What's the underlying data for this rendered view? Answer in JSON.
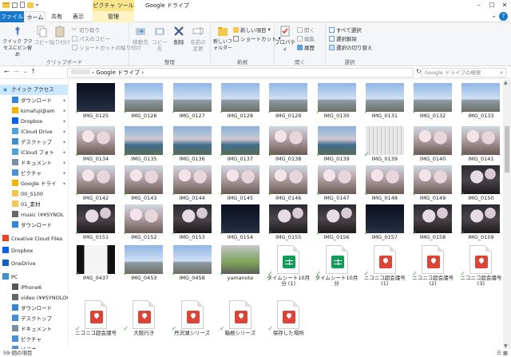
{
  "titlebar": {
    "context_tab": "ピクチャ ツール",
    "title": "Google ドライブ",
    "colors": {
      "accent": "#1979ca",
      "context": "#f8e58c"
    }
  },
  "tabs": {
    "file": "ファイル",
    "home": "ホーム",
    "share": "共有",
    "view": "表示",
    "manage": "管理"
  },
  "ribbon": {
    "clipboard": {
      "label": "クリップボード",
      "pin": "クイック アクセスにピン留め",
      "copy": "コピー",
      "paste": "貼り付け",
      "cut": "切り取り",
      "copy_path": "パスのコピー",
      "paste_shortcut": "ショートカットの貼り付け"
    },
    "organize": {
      "label": "整理",
      "move_to": "移動先",
      "copy_to": "コピー先",
      "delete": "削除",
      "rename": "名前の変更"
    },
    "new": {
      "label": "新規",
      "new_folder": "新しいフォルダー",
      "new_item": "新しい項目",
      "shortcut": "ショートカット"
    },
    "open": {
      "label": "開く",
      "properties": "プロパティ",
      "open": "開く",
      "edit": "編集",
      "history": "履歴"
    },
    "select": {
      "label": "選択",
      "select_all": "すべて選択",
      "select_none": "選択解除",
      "invert": "選択の切り替え"
    }
  },
  "address": {
    "path_root": "Google ドライブ",
    "search_placeholder": "Google ドライブの検索"
  },
  "nav": {
    "items": [
      {
        "label": "クイック アクセス",
        "icon": "star-icon",
        "color": "#2e86de"
      },
      {
        "label": "ダウンロード",
        "icon": "download-icon",
        "color": "#2e86de"
      },
      {
        "label": "kimafuji@am",
        "icon": "google-drive-icon",
        "color": "#f4b400"
      },
      {
        "label": "Dropbox",
        "icon": "dropbox-icon",
        "color": "#0061ff"
      },
      {
        "label": "iCloud Drive",
        "icon": "icloud-icon",
        "color": "#4aa3df"
      },
      {
        "label": "デスクトップ",
        "icon": "desktop-icon",
        "color": "#3d8fd8"
      },
      {
        "label": "iCloud フォト",
        "icon": "icloud-photo-icon",
        "color": "#4aa3df"
      },
      {
        "label": "ドキュメント",
        "icon": "document-icon",
        "color": "#7b8ea3"
      },
      {
        "label": "ピクチャ",
        "icon": "pictures-icon",
        "color": "#4a90d9"
      },
      {
        "label": "Google ドライ",
        "icon": "google-drive-icon",
        "color": "#f4b400"
      },
      {
        "label": "00_S100",
        "icon": "folder-icon",
        "color": "#f2c94c"
      },
      {
        "label": "01_素材",
        "icon": "folder-icon",
        "color": "#f2c94c"
      },
      {
        "label": "music (¥¥SYNOL",
        "icon": "network-drive-icon",
        "color": "#666666"
      },
      {
        "label": "ダウンロード",
        "icon": "download-icon",
        "color": "#2e86de"
      },
      {
        "label": "Creative Cloud Files",
        "icon": "creative-cloud-icon",
        "color": "#e8462b"
      },
      {
        "label": "Dropbox",
        "icon": "dropbox-icon",
        "color": "#0061ff"
      },
      {
        "label": "OneDrive",
        "icon": "onedrive-icon",
        "color": "#0a64c8"
      },
      {
        "label": "PC",
        "icon": "pc-icon",
        "color": "#3d8fd8"
      },
      {
        "label": "iPhone6",
        "icon": "phone-icon",
        "color": "#555555"
      },
      {
        "label": "video (¥¥SYNOLOG",
        "icon": "network-drive-icon",
        "color": "#666666"
      },
      {
        "label": "ダウンロード",
        "icon": "download-icon",
        "color": "#2e86de"
      },
      {
        "label": "デスクトップ",
        "icon": "desktop-icon",
        "color": "#3d8fd8"
      },
      {
        "label": "ドキュメント",
        "icon": "document-icon",
        "color": "#7b8ea3"
      },
      {
        "label": "ピクチャ",
        "icon": "pictures-icon",
        "color": "#4a90d9"
      },
      {
        "label": "ビデオ",
        "icon": "video-icon",
        "color": "#4a90d9"
      }
    ]
  },
  "files": [
    {
      "name": "IMG_0125",
      "kind": "photo",
      "style": "night"
    },
    {
      "name": "IMG_0126",
      "kind": "photo",
      "style": "sky"
    },
    {
      "name": "IMG_0127",
      "kind": "photo",
      "style": "sky"
    },
    {
      "name": "IMG_0128",
      "kind": "photo",
      "style": "sky"
    },
    {
      "name": "IMG_0129",
      "kind": "photo",
      "style": "sky"
    },
    {
      "name": "IMG_0130",
      "kind": "photo",
      "style": "sky"
    },
    {
      "name": "IMG_0131",
      "kind": "photo",
      "style": "sky"
    },
    {
      "name": "IMG_0132",
      "kind": "photo",
      "style": "sky"
    },
    {
      "name": "IMG_0133",
      "kind": "photo",
      "style": "sky"
    },
    {
      "name": "IMG_0134",
      "kind": "photo",
      "style": "blossom"
    },
    {
      "name": "IMG_0135",
      "kind": "photo",
      "style": "river"
    },
    {
      "name": "IMG_0136",
      "kind": "photo",
      "style": "river"
    },
    {
      "name": "IMG_0137",
      "kind": "photo",
      "style": "river"
    },
    {
      "name": "IMG_0138",
      "kind": "photo",
      "style": "blossom"
    },
    {
      "name": "IMG_0139",
      "kind": "photo",
      "style": "river"
    },
    {
      "name": "IMG_0139",
      "kind": "photo",
      "style": "keyboard"
    },
    {
      "name": "IMG_0140",
      "kind": "photo",
      "style": "blossom"
    },
    {
      "name": "IMG_0141",
      "kind": "photo",
      "style": "blossom"
    },
    {
      "name": "IMG_0142",
      "kind": "photo",
      "style": "blossom"
    },
    {
      "name": "IMG_0143",
      "kind": "photo",
      "style": "blossom"
    },
    {
      "name": "IMG_0144",
      "kind": "photo",
      "style": "blossom"
    },
    {
      "name": "IMG_0145",
      "kind": "photo",
      "style": "blossom"
    },
    {
      "name": "IMG_0146",
      "kind": "photo",
      "style": "blossom"
    },
    {
      "name": "IMG_0147",
      "kind": "photo",
      "style": "blossom"
    },
    {
      "name": "IMG_0148",
      "kind": "photo",
      "style": "blossom"
    },
    {
      "name": "IMG_0149",
      "kind": "photo",
      "style": "blossom"
    },
    {
      "name": "IMG_0150",
      "kind": "photo",
      "style": "blossomdark"
    },
    {
      "name": "IMG_0151",
      "kind": "photo",
      "style": "blossomdark"
    },
    {
      "name": "IMG_0152",
      "kind": "photo",
      "style": "blossom"
    },
    {
      "name": "IMG_0153",
      "kind": "photo",
      "style": "blossomdark"
    },
    {
      "name": "IMG_0154",
      "kind": "photo",
      "style": "night"
    },
    {
      "name": "IMG_0155",
      "kind": "photo",
      "style": "blossomdark"
    },
    {
      "name": "IMG_0156",
      "kind": "photo",
      "style": "blossomdark"
    },
    {
      "name": "IMG_0157",
      "kind": "photo",
      "style": "night"
    },
    {
      "name": "IMG_0158",
      "kind": "photo",
      "style": "blossomdark"
    },
    {
      "name": "IMG_0159",
      "kind": "photo",
      "style": "blossomdark"
    },
    {
      "name": "IMG_0437",
      "kind": "photo",
      "style": "screen"
    },
    {
      "name": "IMG_0453",
      "kind": "photo",
      "style": "sky"
    },
    {
      "name": "IMG_0458",
      "kind": "photo",
      "style": "sky"
    },
    {
      "name": "yamanote",
      "kind": "photo",
      "style": "train"
    },
    {
      "name": "タイムシート10月分 (1)",
      "kind": "sheet"
    },
    {
      "name": "タイムシート10月分",
      "kind": "sheet"
    },
    {
      "name": "ニコニコ超会議号 (1)",
      "kind": "map"
    },
    {
      "name": "ニコニコ超会議号 (2)",
      "kind": "map"
    },
    {
      "name": "ニコニコ超会議号 (3)",
      "kind": "map"
    },
    {
      "name": "ニコニコ超会議号",
      "kind": "map"
    },
    {
      "name": "大阪行き",
      "kind": "map"
    },
    {
      "name": "丹沢湖シリーズ",
      "kind": "map"
    },
    {
      "name": "箱根シリーズ",
      "kind": "map"
    },
    {
      "name": "保存した場所",
      "kind": "map"
    }
  ],
  "status": {
    "count": "59 個の項目"
  },
  "palette": {
    "sheet": "#0f9d58",
    "map": "#db4437",
    "check": "#3a9e3a"
  }
}
